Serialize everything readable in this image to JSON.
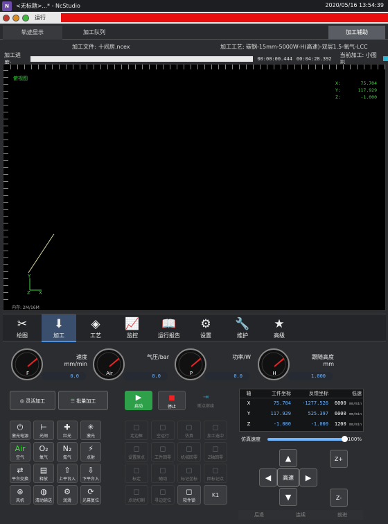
{
  "window": {
    "title": "<无标题>...* - NcStudio",
    "datetime": "2020/05/16 13:54:39"
  },
  "toolbar": {
    "run_label": "运行",
    "accent": "#ea0f0f"
  },
  "tabs": {
    "track": "轨迹显示",
    "queue": "加工队列",
    "assist": "加工辅助"
  },
  "fileinfo": {
    "file_label": "加工文件:",
    "file_name": "十间房.ncex",
    "process_label": "加工工艺:",
    "process_value": "碳钢-15mm-5000W-H(高速)-双层1.5-氧气-LCC"
  },
  "progress": {
    "label": "加工进度:",
    "elapsed": "00:00:00.444",
    "total": "00:04:28.392",
    "current_label": "当前加工: 小图形",
    "fraction": 0.0
  },
  "canvas": {
    "view_label": "俯视图",
    "x_label": "X:",
    "x_value": "75.704",
    "y_label": "Y:",
    "y_value": "117.929",
    "z_label": "Z:",
    "z_value": "-1.000",
    "mem": "内存: 2M/16M",
    "axis_y": "Y",
    "axis_z": "Z",
    "axis_x": "X"
  },
  "nav": [
    {
      "label": "绘图",
      "icon": "✂"
    },
    {
      "label": "加工",
      "icon": "⬇"
    },
    {
      "label": "工艺",
      "icon": "◈"
    },
    {
      "label": "监控",
      "icon": "📈"
    },
    {
      "label": "运行报告",
      "icon": "📖"
    },
    {
      "label": "设置",
      "icon": "⚙"
    },
    {
      "label": "维护",
      "icon": "🔧"
    },
    {
      "label": "高级",
      "icon": "★"
    }
  ],
  "gauges": [
    {
      "letter": "F",
      "label": "速度\nmm/min",
      "value": "0.0"
    },
    {
      "letter": "Air",
      "label": "气压/bar",
      "value": "0.0"
    },
    {
      "letter": "P",
      "label": "功率/W",
      "value": "0.0"
    },
    {
      "letter": "H",
      "label": "跟随高度\nmm",
      "value": "1.000"
    }
  ],
  "modes": {
    "flex": "灵活加工",
    "batch": "批量加工"
  },
  "controls": {
    "start": "启动",
    "stop": "停止",
    "resume": "断点继续"
  },
  "axes": {
    "headers": [
      "轴",
      "工件坐标",
      "反馈坐标",
      "低速"
    ],
    "rows": [
      {
        "axis": "X",
        "work": "75.704",
        "feedback": "-1277.526",
        "speed": "6000",
        "unit": "mm/min"
      },
      {
        "axis": "Y",
        "work": "117.929",
        "feedback": "525.397",
        "speed": "6000",
        "unit": "mm/min"
      },
      {
        "axis": "Z",
        "work": "-1.000",
        "feedback": "-1.000",
        "speed": "1200",
        "unit": "mm/min"
      }
    ]
  },
  "sim": {
    "label": "仿真速度",
    "value": "100%",
    "fraction": 1.0
  },
  "grid_left": [
    [
      "激光电源",
      "光闸",
      "红光",
      "激光"
    ],
    [
      "空气",
      "氧气",
      "氮气",
      "点射"
    ],
    [
      "平台交换",
      "释放",
      "上平台入",
      "下平台入"
    ],
    [
      "风机",
      "清动输送",
      "润滑",
      "光幕复位"
    ]
  ],
  "grid_left_icons": [
    [
      "⏻",
      "⊢",
      "✚",
      "✳"
    ],
    [
      "Air",
      "O₂",
      "N₂",
      "⚡"
    ],
    [
      "⇄",
      "▤",
      "⇧",
      "⇩"
    ],
    [
      "⊛",
      "◍",
      "⚙",
      "⟳"
    ]
  ],
  "grid_mid": [
    [
      "走边框",
      "空运行",
      "仿真",
      "加工选中"
    ],
    [
      "设置原点",
      "工件回零",
      "机械回零",
      "Z轴回零"
    ],
    [
      "标定",
      "随动",
      "标记坐标",
      "回标记点"
    ],
    [
      "点动切割",
      "寻边定位",
      "软件锁",
      "K1"
    ]
  ],
  "jog": {
    "up": "▲",
    "down": "▼",
    "left": "◀",
    "right": "▶",
    "center": "高速",
    "zplus": "Z+",
    "zminus": "Z-"
  },
  "pager": {
    "prev": "后退",
    "next": "前进",
    "mid": "连续"
  }
}
